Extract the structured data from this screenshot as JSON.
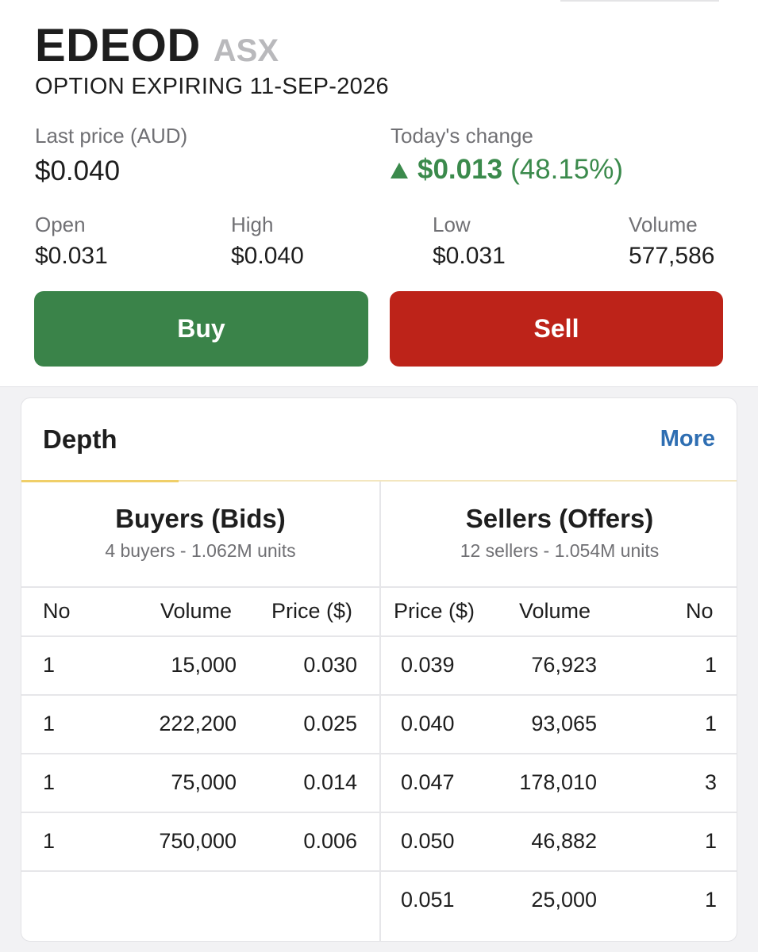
{
  "header": {
    "ticker": "EDEOD",
    "exchange": "ASX",
    "subtitle": "OPTION EXPIRING 11-SEP-2026"
  },
  "quote": {
    "last_price_label": "Last price (AUD)",
    "last_price": "$0.040",
    "change_label": "Today's change",
    "change_value": "$0.013",
    "change_pct": "(48.15%)",
    "change_direction": "up",
    "change_color": "#3b8a4c",
    "open_label": "Open",
    "open": "$0.031",
    "high_label": "High",
    "high": "$0.040",
    "low_label": "Low",
    "low": "$0.031",
    "volume_label": "Volume",
    "volume": "577,586"
  },
  "actions": {
    "buy_label": "Buy",
    "buy_color": "#3a8349",
    "sell_label": "Sell",
    "sell_color": "#bd2319"
  },
  "depth": {
    "title": "Depth",
    "more_label": "More",
    "buyers": {
      "title": "Buyers (Bids)",
      "summary": "4 buyers - 1.062M units",
      "columns": [
        "No",
        "Volume",
        "Price ($)"
      ],
      "rows": [
        {
          "no": "1",
          "volume": "15,000",
          "price": "0.030"
        },
        {
          "no": "1",
          "volume": "222,200",
          "price": "0.025"
        },
        {
          "no": "1",
          "volume": "75,000",
          "price": "0.014"
        },
        {
          "no": "1",
          "volume": "750,000",
          "price": "0.006"
        }
      ]
    },
    "sellers": {
      "title": "Sellers (Offers)",
      "summary": "12 sellers - 1.054M units",
      "columns": [
        "Price ($)",
        "Volume",
        "No"
      ],
      "rows": [
        {
          "price": "0.039",
          "volume": "76,923",
          "no": "1"
        },
        {
          "price": "0.040",
          "volume": "93,065",
          "no": "1"
        },
        {
          "price": "0.047",
          "volume": "178,010",
          "no": "3"
        },
        {
          "price": "0.050",
          "volume": "46,882",
          "no": "1"
        },
        {
          "price": "0.051",
          "volume": "25,000",
          "no": "1"
        }
      ]
    }
  }
}
